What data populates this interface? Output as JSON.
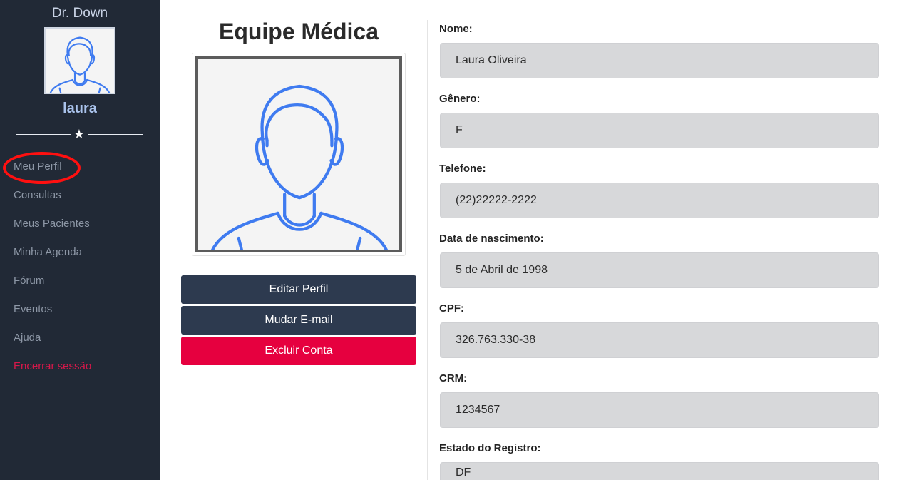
{
  "sidebar": {
    "brand": "Dr. Down",
    "username": "laura",
    "nav": [
      {
        "label": "Meu Perfil"
      },
      {
        "label": "Consultas"
      },
      {
        "label": "Meus Pacientes"
      },
      {
        "label": "Minha Agenda"
      },
      {
        "label": "Fórum"
      },
      {
        "label": "Eventos"
      },
      {
        "label": "Ajuda"
      },
      {
        "label": "Encerrar sessão"
      }
    ],
    "divider_icon": "star-icon"
  },
  "main": {
    "title": "Equipe Médica",
    "buttons": {
      "edit": "Editar Perfil",
      "email": "Mudar E-mail",
      "delete": "Excluir Conta"
    }
  },
  "profile": {
    "fields": [
      {
        "label": "Nome:",
        "value": "Laura Oliveira"
      },
      {
        "label": "Gênero:",
        "value": "F"
      },
      {
        "label": "Telefone:",
        "value": "(22)22222-2222"
      },
      {
        "label": "Data de nascimento:",
        "value": "5 de Abril de 1998"
      },
      {
        "label": "CPF:",
        "value": "326.763.330-38"
      },
      {
        "label": "CRM:",
        "value": "1234567"
      },
      {
        "label": "Estado do Registro:",
        "value": "DF"
      }
    ]
  },
  "colors": {
    "sidebar_bg": "#212936",
    "accent_dark": "#2d3a4f",
    "danger": "#e6003f",
    "logout_text": "#d6184a",
    "avatar_stroke": "#3f7bf0"
  }
}
